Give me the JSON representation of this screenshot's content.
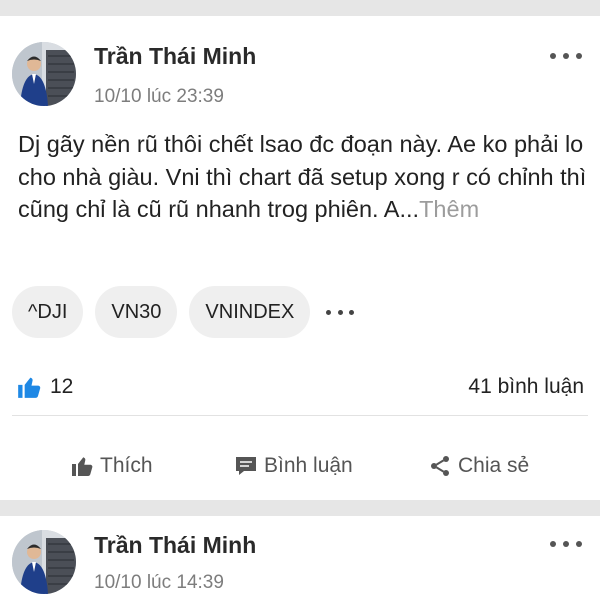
{
  "feed": {
    "posts": [
      {
        "author": "Trần Thái Minh",
        "time": "10/10 lúc 23:39",
        "body": "Dj gãy nền rũ thôi chết lsao đc đoạn này. Ae ko phải lo cho nhà giàu. Vni thì chart đã setup xong r có chỉnh thì cũng chỉ là cũ rũ nhanh trog phiên. A...",
        "more_label": "Thêm",
        "tags": [
          "^DJI",
          "VN30",
          "VNINDEX"
        ],
        "likes": "12",
        "comments": "41 bình luận",
        "actions": {
          "like": "Thích",
          "comment": "Bình luận",
          "share": "Chia sẻ"
        }
      },
      {
        "author": "Trần Thái Minh",
        "time": "10/10 lúc 14:39"
      }
    ]
  },
  "icons": {
    "like": "thumbs-up-icon",
    "comment": "comment-icon",
    "share": "share-icon",
    "more": "more-horizontal-icon"
  },
  "colors": {
    "like_blue": "#1e88e5",
    "action_gray": "#555555",
    "muted_text": "#7d7d7d",
    "tag_bg": "#efefef",
    "separator": "#e6e6e6"
  }
}
